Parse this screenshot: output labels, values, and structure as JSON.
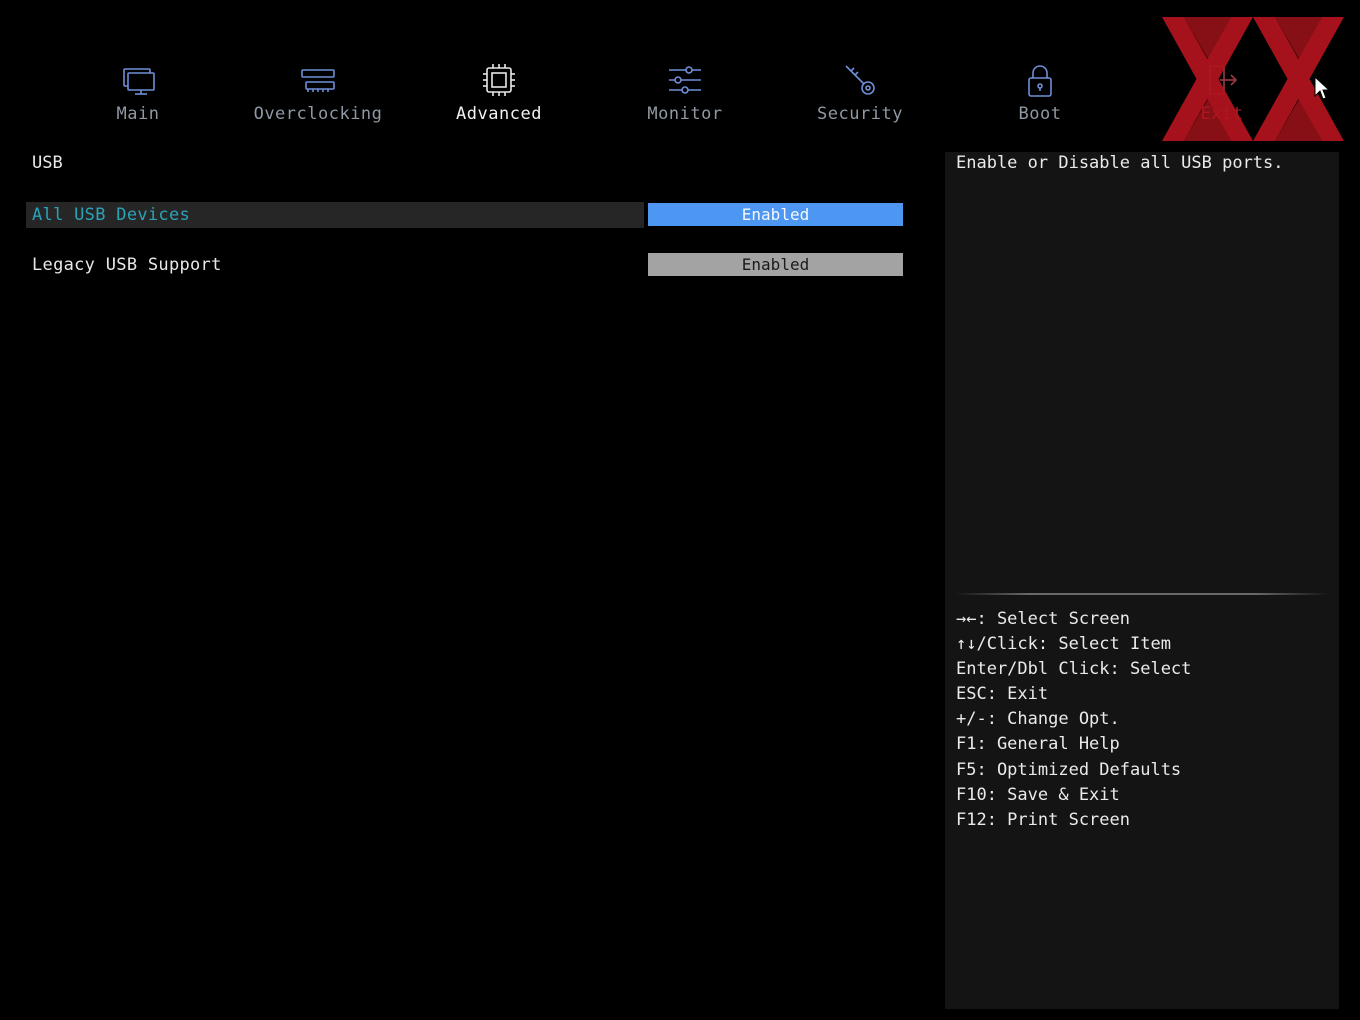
{
  "nav": {
    "tabs": [
      {
        "label": "Main",
        "icon": "monitor-icon"
      },
      {
        "label": "Overclocking",
        "icon": "memory-icon"
      },
      {
        "label": "Advanced",
        "icon": "chip-icon"
      },
      {
        "label": "Monitor",
        "icon": "sliders-icon"
      },
      {
        "label": "Security",
        "icon": "key-icon"
      },
      {
        "label": "Boot",
        "icon": "lock-icon"
      },
      {
        "label": "Exit",
        "icon": "exit-icon"
      }
    ],
    "active": "Advanced"
  },
  "content": {
    "section_title": "USB",
    "items": [
      {
        "label": "All USB Devices",
        "value": "Enabled",
        "selected": true
      },
      {
        "label": "Legacy USB Support",
        "value": "Enabled",
        "selected": false
      }
    ]
  },
  "help": {
    "description": "Enable or Disable all USB ports.",
    "keys": [
      "→←: Select Screen",
      "↑↓/Click: Select Item",
      "Enter/Dbl Click: Select",
      "ESC: Exit",
      "+/-: Change Opt.",
      "F1: General Help",
      "F5: Optimized Defaults",
      "F10: Save & Exit",
      "F12: Print Screen"
    ]
  },
  "colors": {
    "selected_value_bg": "#4d97f2",
    "value_bg": "#a3a3a3",
    "selected_label_text": "#2aa3b8",
    "icon_color": "#6f8fd8",
    "watermark_red": "#b4141e"
  }
}
